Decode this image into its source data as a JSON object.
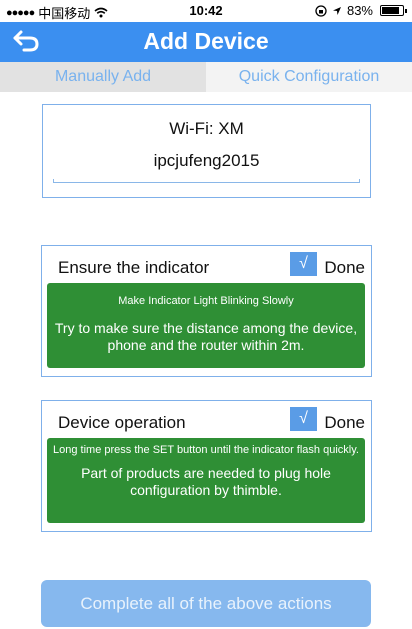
{
  "status_bar": {
    "carrier": "中国移动",
    "signal_icon": "signal-dots-icon",
    "wifi_icon": "wifi-icon",
    "time": "10:42",
    "lock_icon": "orientation-lock-icon",
    "location_icon": "location-arrow-icon",
    "battery_percent_text": "83%",
    "battery_level": 0.83
  },
  "nav": {
    "back_icon": "back-arrow-icon",
    "title": "Add Device"
  },
  "tabs": {
    "manual": "Manually Add",
    "quick": "Quick Configuration",
    "selected": "quick"
  },
  "wifi": {
    "ssid_text": "Wi-Fi:  XM",
    "password": "ipcjufeng2015"
  },
  "steps": [
    {
      "title": "Ensure the indicator",
      "check": "√",
      "done_label": "Done",
      "hint_small": "Make Indicator Light Blinking Slowly",
      "hint_main": "Try to make sure the distance among the device, phone and the router within 2m."
    },
    {
      "title": "Device operation",
      "check": "√",
      "done_label": "Done",
      "hint_small": "Long time press the SET button until the indicator flash quickly.",
      "hint_main": "Part of products are needed to plug hole configuration by thimble."
    }
  ],
  "complete_button": "Complete all of the above actions",
  "colors": {
    "nav_blue": "#3b8ff0",
    "card_border": "#7fb0ea",
    "green_panel": "#2f8f35",
    "button_blue": "#86b8ee",
    "tab_text": "#79b2ee"
  }
}
